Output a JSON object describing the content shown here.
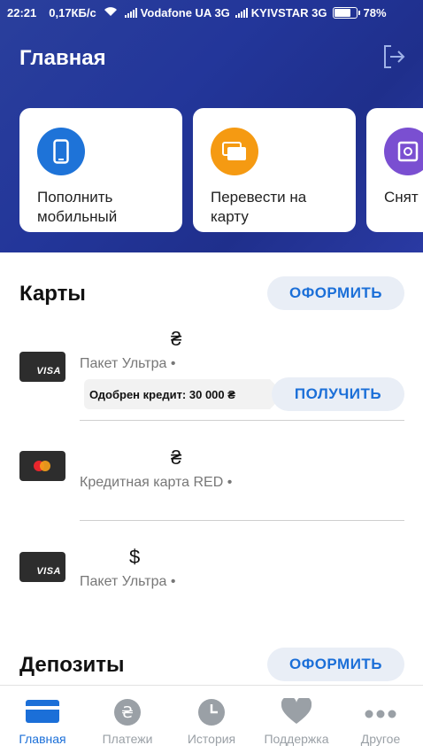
{
  "status_bar": {
    "time": "22:21",
    "speed": "0,17КБ/с",
    "operator1": "Vodafone UA 3G",
    "operator2": "KYIVSTAR 3G",
    "battery": "78%",
    "battery_level": 0.78
  },
  "header": {
    "title": "Главная"
  },
  "quick_actions": [
    {
      "label": "Пополнить мобильный",
      "icon": "mobile-phone-icon",
      "color": "#1e73d8"
    },
    {
      "label": "Перевести на карту",
      "icon": "card-transfer-icon",
      "color": "#f59a12"
    },
    {
      "label": "Снят",
      "icon": "cash-withdraw-icon",
      "color": "#7a4fd1"
    }
  ],
  "cards_section": {
    "title": "Карты",
    "action_label": "ОФОРМИТЬ",
    "items": [
      {
        "brand": "VISA",
        "currency": "₴",
        "name": "Пакет Ультра",
        "dot": "•"
      },
      {
        "brand": "mastercard",
        "currency": "₴",
        "name": "Кредитная карта RED",
        "dot": "•"
      },
      {
        "brand": "VISA",
        "currency": "$",
        "name": "Пакет Ультра",
        "dot": "•"
      }
    ],
    "credit_offer": {
      "text": "Одобрен кредит: 30 000 ₴",
      "action_label": "ПОЛУЧИТЬ"
    }
  },
  "deposits_section": {
    "title": "Депозиты",
    "action_label": "ОФОРМИТЬ"
  },
  "tab_bar": {
    "active": "Главная",
    "accent": "#1b6fd8",
    "items": [
      {
        "label": "Главная",
        "icon": "home-card-icon"
      },
      {
        "label": "Платежи",
        "icon": "hryvnia-icon"
      },
      {
        "label": "История",
        "icon": "clock-icon"
      },
      {
        "label": "Поддержка",
        "icon": "heart-icon"
      },
      {
        "label": "Другое",
        "icon": "more-dots-icon"
      }
    ]
  }
}
